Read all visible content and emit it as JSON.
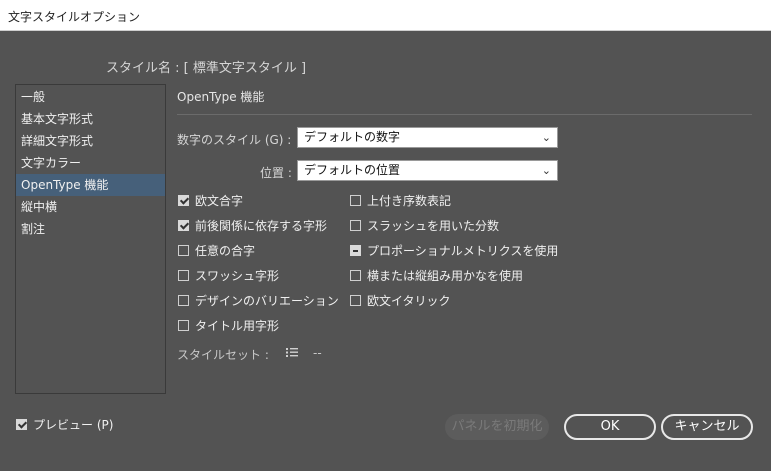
{
  "window": {
    "title": "文字スタイルオプション"
  },
  "style_name": {
    "label": "スタイル名 :",
    "value": "[ 標準文字スタイル ]"
  },
  "sidebar": {
    "items": [
      {
        "label": "一般",
        "selected": false
      },
      {
        "label": "基本文字形式",
        "selected": false
      },
      {
        "label": "詳細文字形式",
        "selected": false
      },
      {
        "label": "文字カラー",
        "selected": false
      },
      {
        "label": "OpenType 機能",
        "selected": true
      },
      {
        "label": "縦中横",
        "selected": false
      },
      {
        "label": "割注",
        "selected": false
      }
    ]
  },
  "panel": {
    "title": "OpenType 機能",
    "number_style": {
      "label": "数字のスタイル (G) :",
      "value": "デフォルトの数字"
    },
    "position": {
      "label": "位置 :",
      "value": "デフォルトの位置"
    },
    "checkboxes_left": [
      {
        "label": "欧文合字",
        "state": "checked"
      },
      {
        "label": "前後関係に依存する字形",
        "state": "checked"
      },
      {
        "label": "任意の合字",
        "state": "unchecked"
      },
      {
        "label": "スワッシュ字形",
        "state": "unchecked"
      },
      {
        "label": "デザインのバリエーション",
        "state": "unchecked"
      },
      {
        "label": "タイトル用字形",
        "state": "unchecked"
      }
    ],
    "checkboxes_right": [
      {
        "label": "上付き序数表記",
        "state": "unchecked"
      },
      {
        "label": "スラッシュを用いた分数",
        "state": "unchecked"
      },
      {
        "label": "プロポーショナルメトリクスを使用",
        "state": "mixed"
      },
      {
        "label": "横または縦組み用かなを使用",
        "state": "unchecked"
      },
      {
        "label": "欧文イタリック",
        "state": "unchecked"
      }
    ],
    "style_set": {
      "label": "スタイルセット :",
      "icon": "list-icon",
      "value": "--"
    }
  },
  "footer": {
    "preview": {
      "label": "プレビュー (P)",
      "state": "checked"
    },
    "reset_label": "パネルを初期化",
    "ok_label": "OK",
    "cancel_label": "キャンセル"
  }
}
